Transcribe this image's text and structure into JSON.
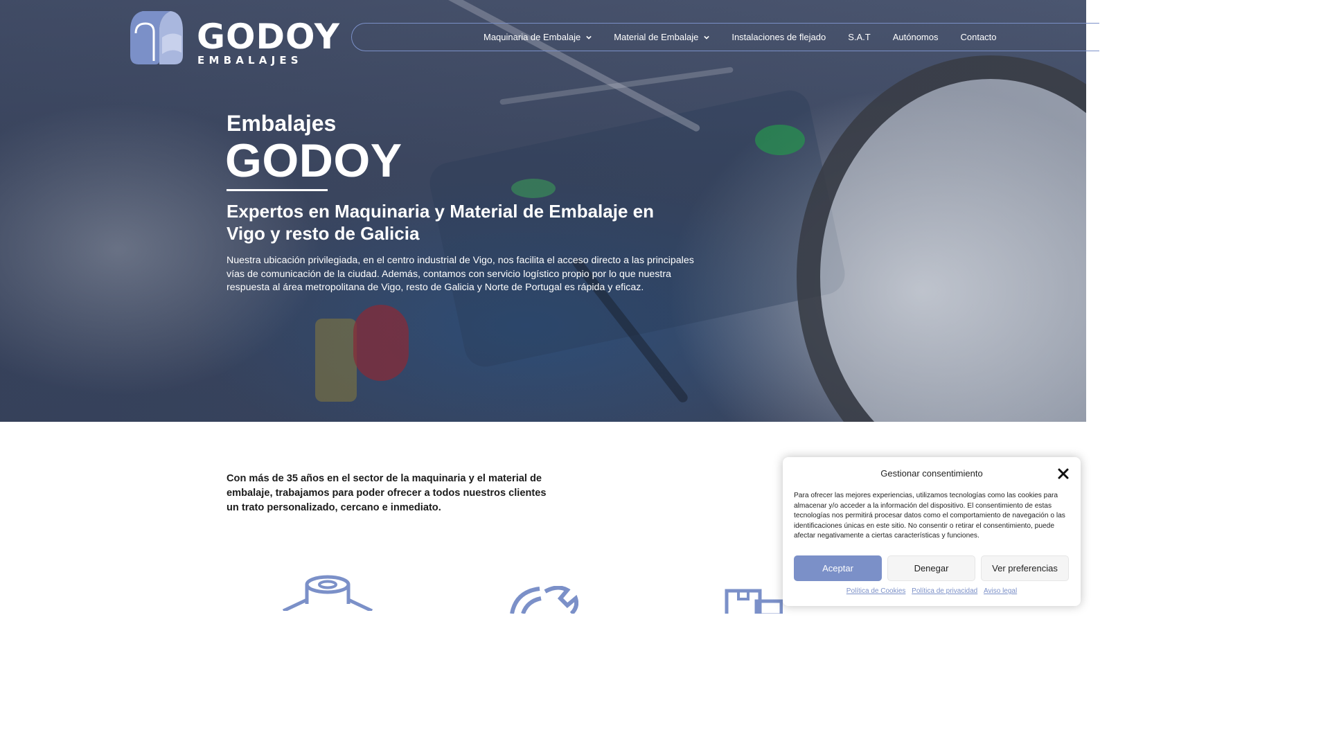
{
  "brand": {
    "name": "GODOY",
    "tagline": "EMBALAJES",
    "accent_color": "#7b90c8"
  },
  "nav": {
    "items": [
      {
        "label": "Maquinaria de Embalaje",
        "has_dropdown": true
      },
      {
        "label": "Material de Embalaje",
        "has_dropdown": true
      },
      {
        "label": "Instalaciones de flejado",
        "has_dropdown": false
      },
      {
        "label": "S.A.T",
        "has_dropdown": false
      },
      {
        "label": "Autónomos",
        "has_dropdown": false
      },
      {
        "label": "Contacto",
        "has_dropdown": false
      }
    ]
  },
  "hero": {
    "pre_title": "Embalajes",
    "title": "GODOY",
    "subtitle": "Expertos en Maquinaria y Material de Embalaje en Vigo y resto de Galicia",
    "paragraph": "Nuestra ubicación privilegiada, en el centro industrial de Vigo, nos facilita el acceso directo a las principales vías de comunicación de la ciudad. Además, contamos con servicio logístico propio por lo que nuestra respuesta al área metropolitana de Vigo, resto de Galicia y Norte de Portugal es rápida y eficaz."
  },
  "intro": {
    "text": "Con más de 35 años en el sector de la maquinaria y el material de embalaje, trabajamos para poder ofrecer a todos nuestros clientes un trato personalizado, cercano e inmediato."
  },
  "features": {
    "icons": [
      "tape-roll-icon",
      "wrench-icon",
      "boxes-icon"
    ]
  },
  "cookie_dialog": {
    "title": "Gestionar consentimiento",
    "text": "Para ofrecer las mejores experiencias, utilizamos tecnologías como las cookies para almacenar y/o acceder a la información del dispositivo. El consentimiento de estas tecnologías nos permitirá procesar datos como el comportamiento de navegación o las identificaciones únicas en este sitio. No consentir o retirar el consentimiento, puede afectar negativamente a ciertas características y funciones.",
    "accept_label": "Aceptar",
    "deny_label": "Denegar",
    "prefs_label": "Ver preferencias",
    "links": [
      "Política de Cookies",
      "Política de privacidad",
      "Aviso legal"
    ]
  }
}
